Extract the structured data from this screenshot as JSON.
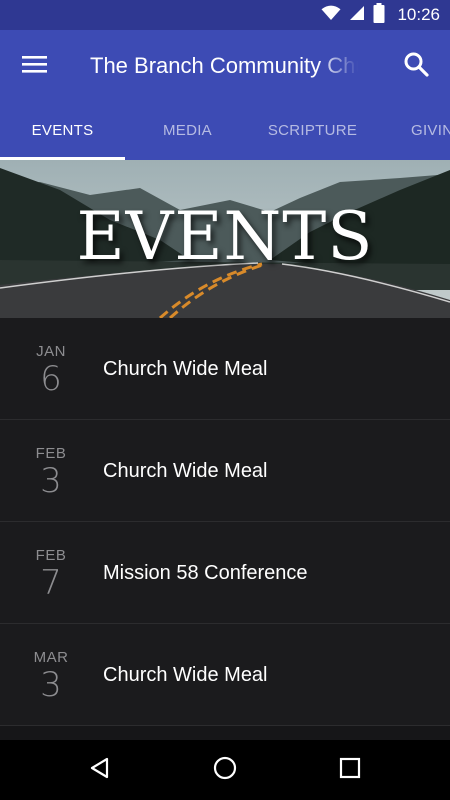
{
  "status_bar": {
    "time": "10:26",
    "icons": [
      "wifi-icon",
      "cell-signal-icon",
      "battery-icon"
    ]
  },
  "app_bar": {
    "title": "The Branch Community Church",
    "menu_icon": "hamburger-menu-icon",
    "search_icon": "search-icon"
  },
  "tabs": [
    {
      "label": "EVENTS",
      "active": true
    },
    {
      "label": "MEDIA",
      "active": false
    },
    {
      "label": "SCRIPTURE",
      "active": false
    },
    {
      "label": "GIVING",
      "active": false
    }
  ],
  "hero": {
    "title": "EVENTS"
  },
  "events": [
    {
      "month": "JAN",
      "day": "6",
      "title": "Church Wide Meal"
    },
    {
      "month": "FEB",
      "day": "3",
      "title": "Church Wide Meal"
    },
    {
      "month": "FEB",
      "day": "7",
      "title": "Mission 58 Conference"
    },
    {
      "month": "MAR",
      "day": "3",
      "title": "Church Wide Meal"
    }
  ],
  "nav_bar": {
    "icons": [
      "back-icon",
      "home-icon",
      "recents-icon"
    ]
  },
  "colors": {
    "status_bar": "#2f3892",
    "app_bar": "#3d4bb4",
    "list_bg": "#1b1b1d",
    "date_text": "#8d8d90"
  }
}
